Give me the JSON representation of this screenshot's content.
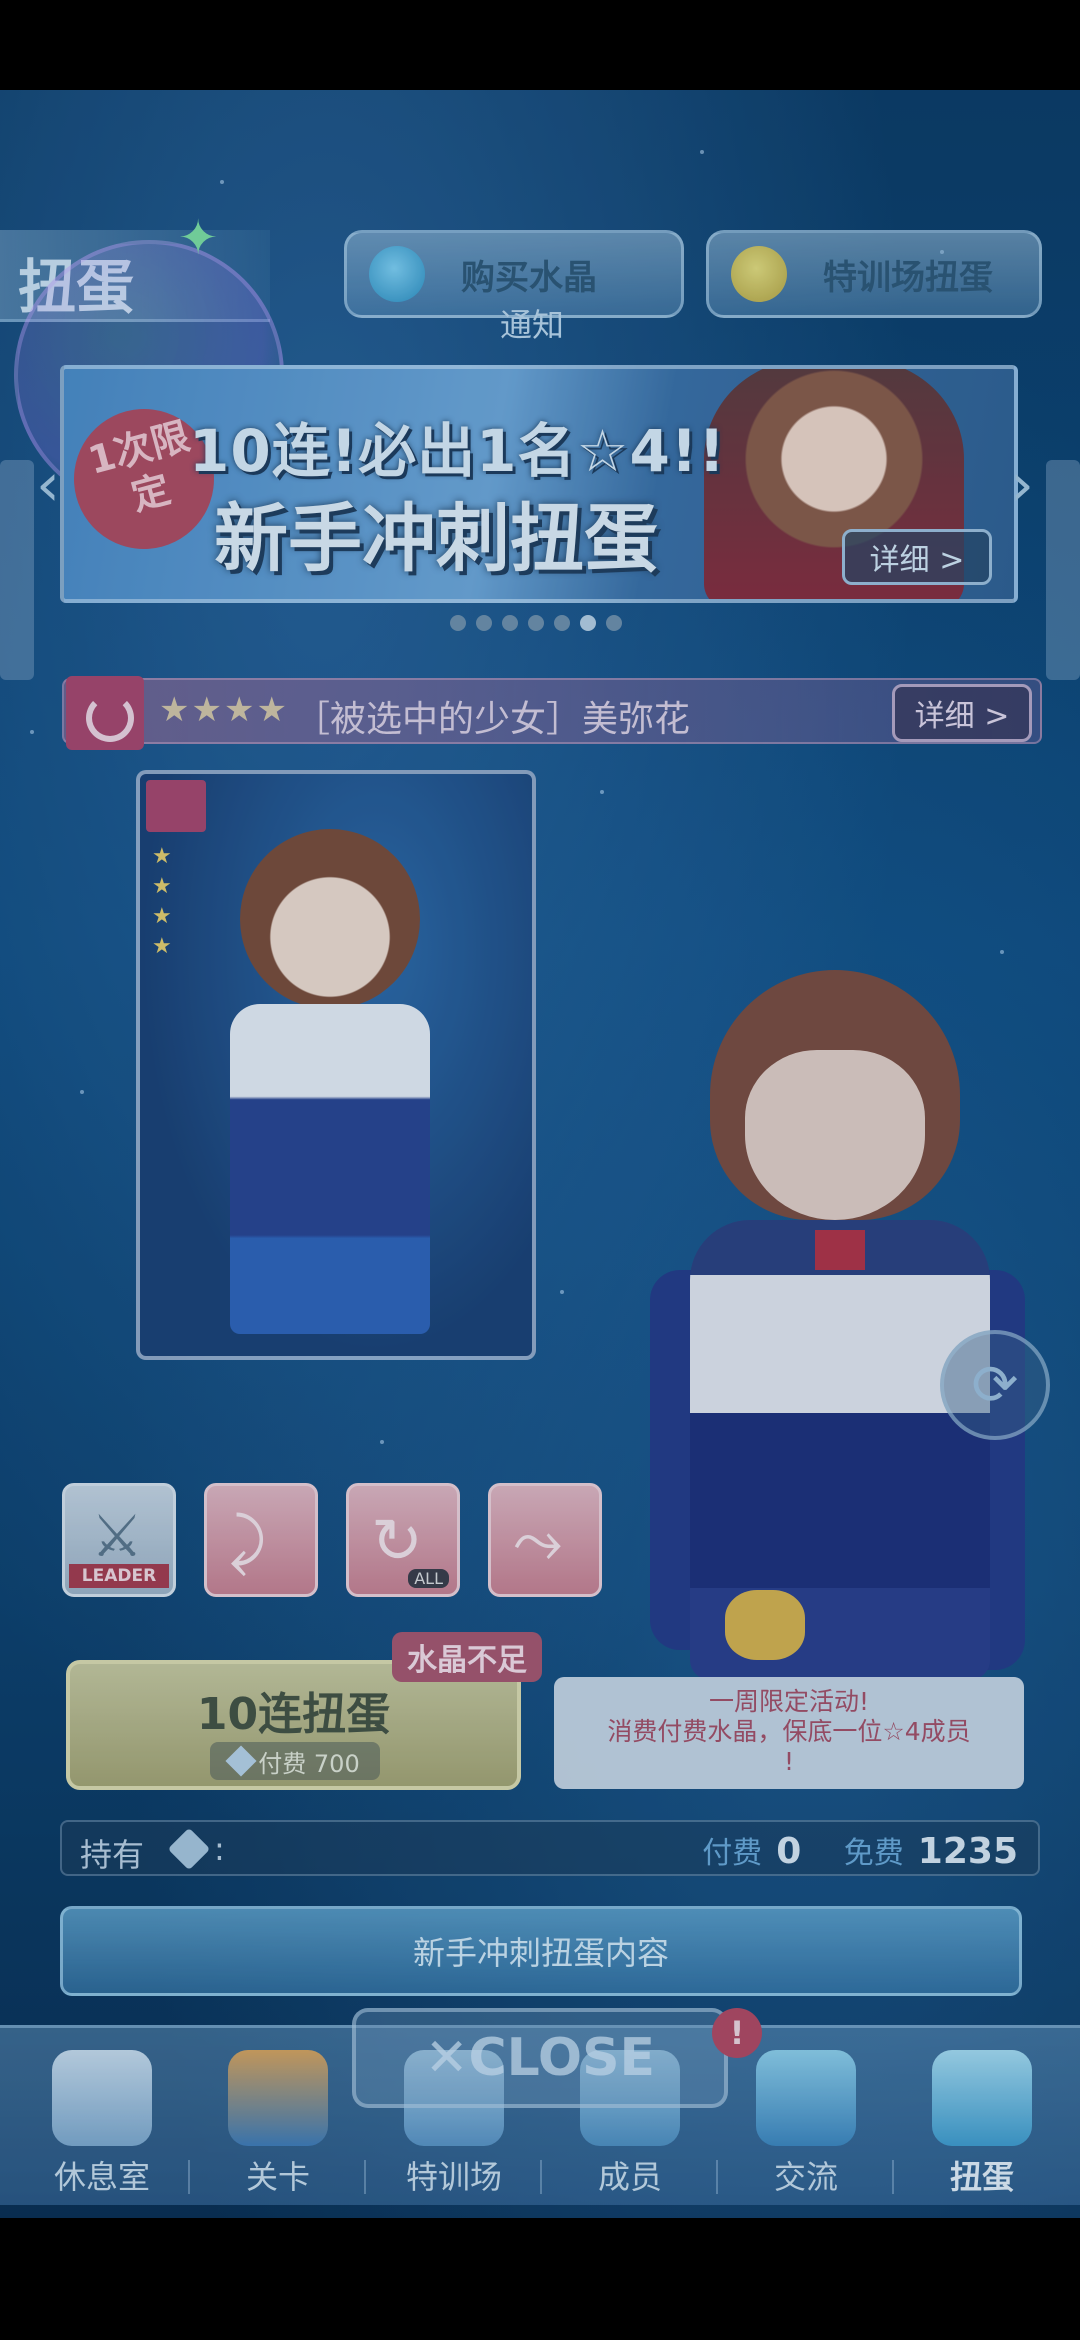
{
  "header": {
    "title": "扭蛋",
    "buy_crystal_label": "购买水晶",
    "training_gacha_label": "特训场扭蛋",
    "notice_label": "通知"
  },
  "banner": {
    "stamp_text": "1次限定",
    "line1": "10连!必出1名☆4!!",
    "line2": "新手冲刺扭蛋",
    "detail_label": "详细 >",
    "page_count": 7,
    "active_page": 6
  },
  "member": {
    "rarity_stars": "★★★★",
    "name": "［被选中的少女］美弥花",
    "detail_label": "详细 >"
  },
  "card": {
    "stars": "★\n★\n★\n★"
  },
  "skills": [
    {
      "icon": "sword-icon",
      "tag": "LEADER"
    },
    {
      "icon": "skill-arm-icon",
      "tag": ""
    },
    {
      "icon": "skill-swirl-icon",
      "tag": "ALL"
    },
    {
      "icon": "skill-slash-icon",
      "tag": ""
    }
  ],
  "gacha": {
    "button_label": "10连扭蛋",
    "cost_label": "付费 700",
    "warning_tag": "水晶不足"
  },
  "popup": {
    "text": "一周限定活动!\n消费付费水晶，保底一位☆4成员\n!"
  },
  "holdings": {
    "label": "持有",
    "colon": ":",
    "paid_label": "付费",
    "paid_value": "0",
    "free_label": "免费",
    "free_value": "1235"
  },
  "content_button_label": "新手冲刺扭蛋内容",
  "close_label": "✕CLOSE",
  "alert_badge": "!",
  "bottom_nav": [
    {
      "label": "休息室",
      "icon": "lounge-icon"
    },
    {
      "label": "关卡",
      "icon": "stage-icon"
    },
    {
      "label": "特训场",
      "icon": "training-icon"
    },
    {
      "label": "成员",
      "icon": "member-icon"
    },
    {
      "label": "交流",
      "icon": "communication-icon"
    },
    {
      "label": "扭蛋",
      "icon": "gacha-icon",
      "active": true
    }
  ],
  "colors": {
    "accent_pink": "#a9456a",
    "gold_button": "#c8c89c",
    "bg_blue": "#0a4678"
  }
}
